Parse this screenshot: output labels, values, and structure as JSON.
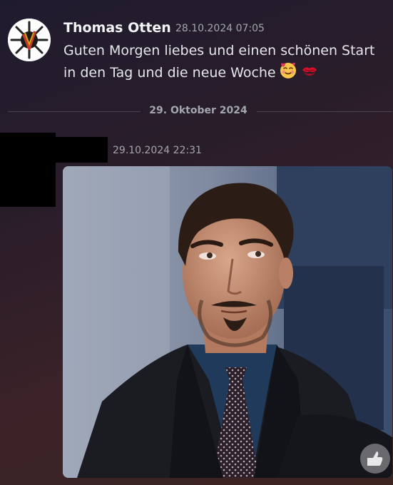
{
  "messages": [
    {
      "author": "Thomas Otten",
      "timestamp": "28.10.2024 07:05",
      "lines": [
        "Guten Morgen liebes und einen schönen Start",
        "in den Tag und die neue Woche"
      ],
      "emojis": [
        "smiling-face-with-hearts-emoji",
        "kiss-mark-emoji"
      ]
    },
    {
      "author_redacted": true,
      "timestamp": "29.10.2024 22:31",
      "attachment": "reaction-gif-man-eye-roll"
    }
  ],
  "date_divider": "29. Oktober 2024",
  "icons": {
    "avatar": "star-shield-avatar",
    "react": "thumbs-up-icon"
  },
  "colors": {
    "username": "#f2f3f5",
    "timestamp": "#a3a6ad",
    "message_text": "#e4e6ea",
    "divider": "#4a4550"
  }
}
